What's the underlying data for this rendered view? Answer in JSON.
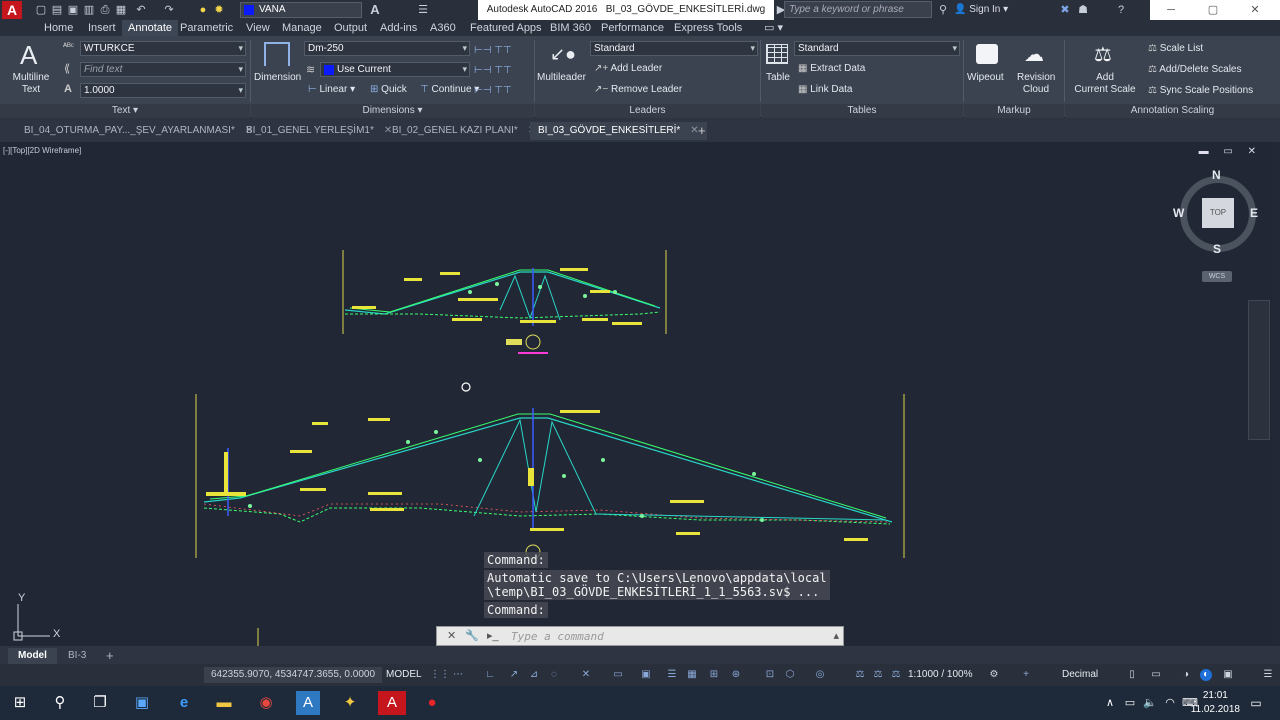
{
  "quick_access": {
    "layer_name": "VANA",
    "layer_color": "#0a1bff"
  },
  "title": {
    "app": "Autodesk AutoCAD 2016",
    "file": "BI_03_GÖVDE_ENKESİTLERİ.dwg"
  },
  "search": {
    "placeholder": "Type a keyword or phrase"
  },
  "user": {
    "sign_in": "Sign In"
  },
  "menu_tabs": [
    "Home",
    "Insert",
    "Annotate",
    "Parametric",
    "View",
    "Manage",
    "Output",
    "Add-ins",
    "A360",
    "Featured Apps",
    "BIM 360",
    "Performance",
    "Express Tools"
  ],
  "active_menu_tab": "Annotate",
  "ribbon": {
    "text": {
      "multiline_label": "Multiline",
      "multiline_label2": "Text",
      "style": "WTURKCE",
      "find_placeholder": "Find text",
      "height": "1.0000",
      "panel": "Text"
    },
    "dimensions": {
      "dimension_label": "Dimension",
      "dim_style": "Dm-250",
      "layer": "Use Current",
      "linear": "Linear",
      "quick": "Quick",
      "continue": "Continue",
      "panel": "Dimensions"
    },
    "leaders": {
      "multileader": "Multileader",
      "style": "Standard",
      "add_leader": "Add Leader",
      "remove_leader": "Remove Leader",
      "panel": "Leaders"
    },
    "tables": {
      "table": "Table",
      "style": "Standard",
      "extract": "Extract Data",
      "link": "Link Data",
      "panel": "Tables"
    },
    "markup": {
      "wipeout": "Wipeout",
      "revision": "Revision",
      "cloud": "Cloud",
      "panel": "Markup"
    },
    "scaling": {
      "add_scale": "Add",
      "add_scale2": "Current Scale",
      "scale_list": "Scale List",
      "add_delete": "Add/Delete Scales",
      "sync": "Sync Scale Positions",
      "panel": "Annotation Scaling"
    }
  },
  "doc_tabs": [
    {
      "label": "BI_04_OTURMA_PAY..._ŞEV_AYARLANMASI*",
      "active": false
    },
    {
      "label": "BI_01_GENEL YERLEŞİM1*",
      "active": false
    },
    {
      "label": "BI_02_GENEL KAZI PLANI*",
      "active": false
    },
    {
      "label": "BI_03_GÖVDE_ENKESİTLERİ*",
      "active": false
    }
  ],
  "active_doc_index": 3,
  "viewport": {
    "label": "[-][Top][2D Wireframe]",
    "viewcube_face": "TOP",
    "compass": {
      "n": "N",
      "s": "S",
      "e": "E",
      "w": "W"
    },
    "wcs": "WCS"
  },
  "command": {
    "history": [
      "Command:",
      "Automatic save to C:\\Users\\Lenovo\\appdata\\local\n\\temp\\BI_03_GÖVDE_ENKESİTLERİ_1_1_5563.sv$ ...",
      "Command:"
    ],
    "placeholder": "Type a command"
  },
  "layout_tabs": [
    "Model",
    "BI-3"
  ],
  "status": {
    "coords": "642355.9070, 4534747.3655, 0.0000",
    "model": "MODEL",
    "scale": "1:1000 / 100%",
    "units": "Decimal"
  },
  "clock": {
    "time": "21:01",
    "date": "11.02.2018"
  },
  "ucs": {
    "x": "X",
    "y": "Y"
  }
}
